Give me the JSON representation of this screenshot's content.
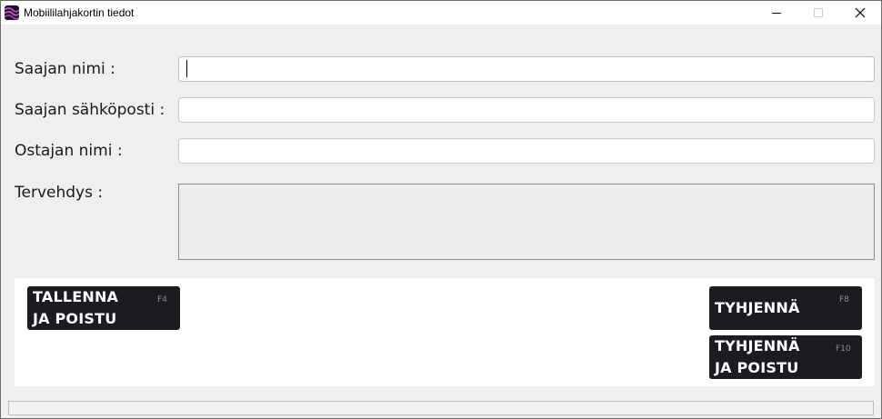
{
  "window": {
    "title": "Mobiililahjakortin tiedot",
    "icon": "app-logo-icon",
    "controls": [
      "minimize-icon",
      "maximize-icon",
      "close-icon"
    ]
  },
  "form": {
    "recipient_name": {
      "label": "Saajan nimi  :",
      "value": ""
    },
    "recipient_email": {
      "label": "Saajan sähköposti :",
      "value": ""
    },
    "buyer_name": {
      "label": "Ostajan nimi :",
      "value": ""
    },
    "greeting": {
      "label": "Tervehdys :",
      "value": ""
    }
  },
  "actions": {
    "save_exit": {
      "label": "TALLENNA\nJA POISTU",
      "key": "F4"
    },
    "clear": {
      "label": "TYHJENNÄ",
      "key": "F8"
    },
    "clear_exit": {
      "label": "TYHJENNÄ\nJA POISTU",
      "key": "F10"
    }
  },
  "colors": {
    "button_bg": "#1b1b22",
    "panel_bg": "#ffffff",
    "window_bg": "#efefef"
  }
}
